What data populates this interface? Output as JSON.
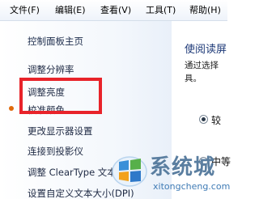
{
  "menubar": {
    "items": [
      {
        "label": "文件(F)"
      },
      {
        "label": "编辑(E)"
      },
      {
        "label": "查看(V)"
      },
      {
        "label": "工具(T)"
      },
      {
        "label": "帮助(H)"
      }
    ]
  },
  "left_pane": {
    "home_link": "控制面板主页",
    "links": [
      {
        "label": "调整分辨率"
      },
      {
        "label": "调整亮度"
      },
      {
        "label": "校准颜色"
      },
      {
        "label": "更改显示器设置"
      },
      {
        "label": "连接到投影仪"
      },
      {
        "label": "调整 ClearType 文本"
      },
      {
        "label": "设置自定义文本大小(DPI)"
      }
    ]
  },
  "right_pane": {
    "title": "使阅读屏",
    "description_line1": "通过选择",
    "description_line2": "具。",
    "option1_label": "较",
    "option2_label": "中等"
  },
  "watermark": {
    "name": "系统城",
    "url": "xitongcheng.com"
  },
  "colors": {
    "highlight": "#e8232a",
    "title_blue": "#1e3a78"
  }
}
